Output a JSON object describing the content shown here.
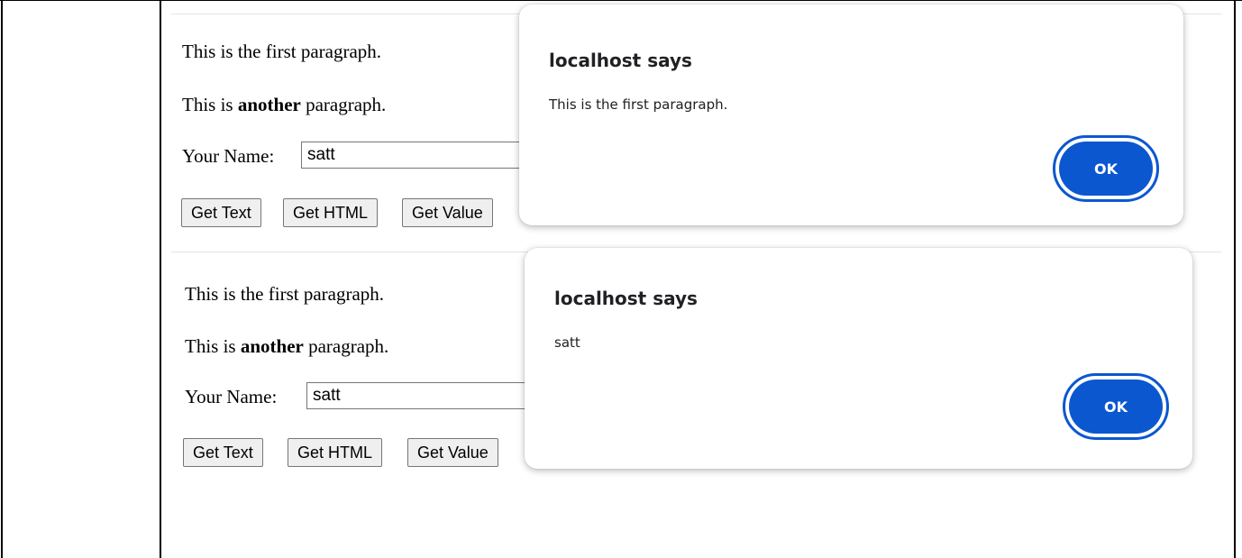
{
  "panels": [
    {
      "paragraph1": "This is the first paragraph.",
      "paragraph2_before": "This is",
      "paragraph2_bold": "another",
      "paragraph2_after": "paragraph.",
      "name_label": "Your Name:",
      "name_value": "satt",
      "buttons": [
        "Get Text",
        "Get HTML",
        "Get Value"
      ],
      "dialog": {
        "title": "localhost says",
        "message": "This is the first paragraph.",
        "ok_label": "OK"
      }
    },
    {
      "paragraph1": "This is the first paragraph.",
      "paragraph2_before": "This is",
      "paragraph2_bold": "another",
      "paragraph2_after": "paragraph.",
      "name_label": "Your Name:",
      "name_value": "satt",
      "buttons": [
        "Get Text",
        "Get HTML",
        "Get Value"
      ],
      "dialog": {
        "title": "localhost says",
        "message": "satt",
        "ok_label": "OK"
      }
    }
  ],
  "colors": {
    "ok_button": "#0b57d0",
    "button_bg": "#efefef"
  }
}
